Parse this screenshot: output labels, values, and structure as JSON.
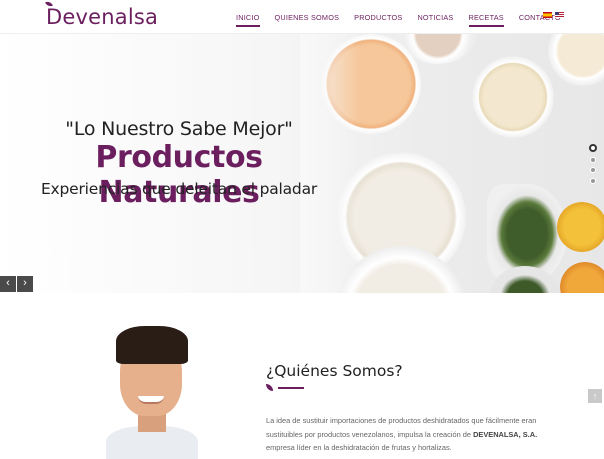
{
  "header": {
    "logo": "Devenalsa",
    "nav": [
      {
        "label": "INICIO",
        "active": true
      },
      {
        "label": "QUIENES SOMOS",
        "active": false
      },
      {
        "label": "PRODUCTOS",
        "active": false
      },
      {
        "label": "NOTICIAS",
        "active": false
      },
      {
        "label": "RECETAS",
        "active": true
      },
      {
        "label": "CONTACTO",
        "active": false
      }
    ],
    "languages": [
      "es-flag-icon",
      "us-flag-icon"
    ]
  },
  "hero": {
    "quote": "\"Lo Nuestro Sabe Mejor\"",
    "headline": "Productos Naturales",
    "subline": "Experiencias que deleitan el paladar",
    "slide_count": 4,
    "active_slide": 1,
    "prev_icon": "‹",
    "next_icon": "›"
  },
  "about": {
    "title": "¿Quiénes Somos?",
    "text_before": "La idea de sustituir importaciones de productos deshidratados que fácilmente eran sustituibles por productos venezolanos, impulsa la creación de ",
    "text_bold": "DEVENALSA, S.A.",
    "text_after": " empresa líder en la deshidratación de frutas y hortalizas."
  },
  "scroll_top_icon": "↑",
  "colors": {
    "brand": "#6b1f5f",
    "text_dark": "#222222",
    "text_muted": "#666666"
  }
}
